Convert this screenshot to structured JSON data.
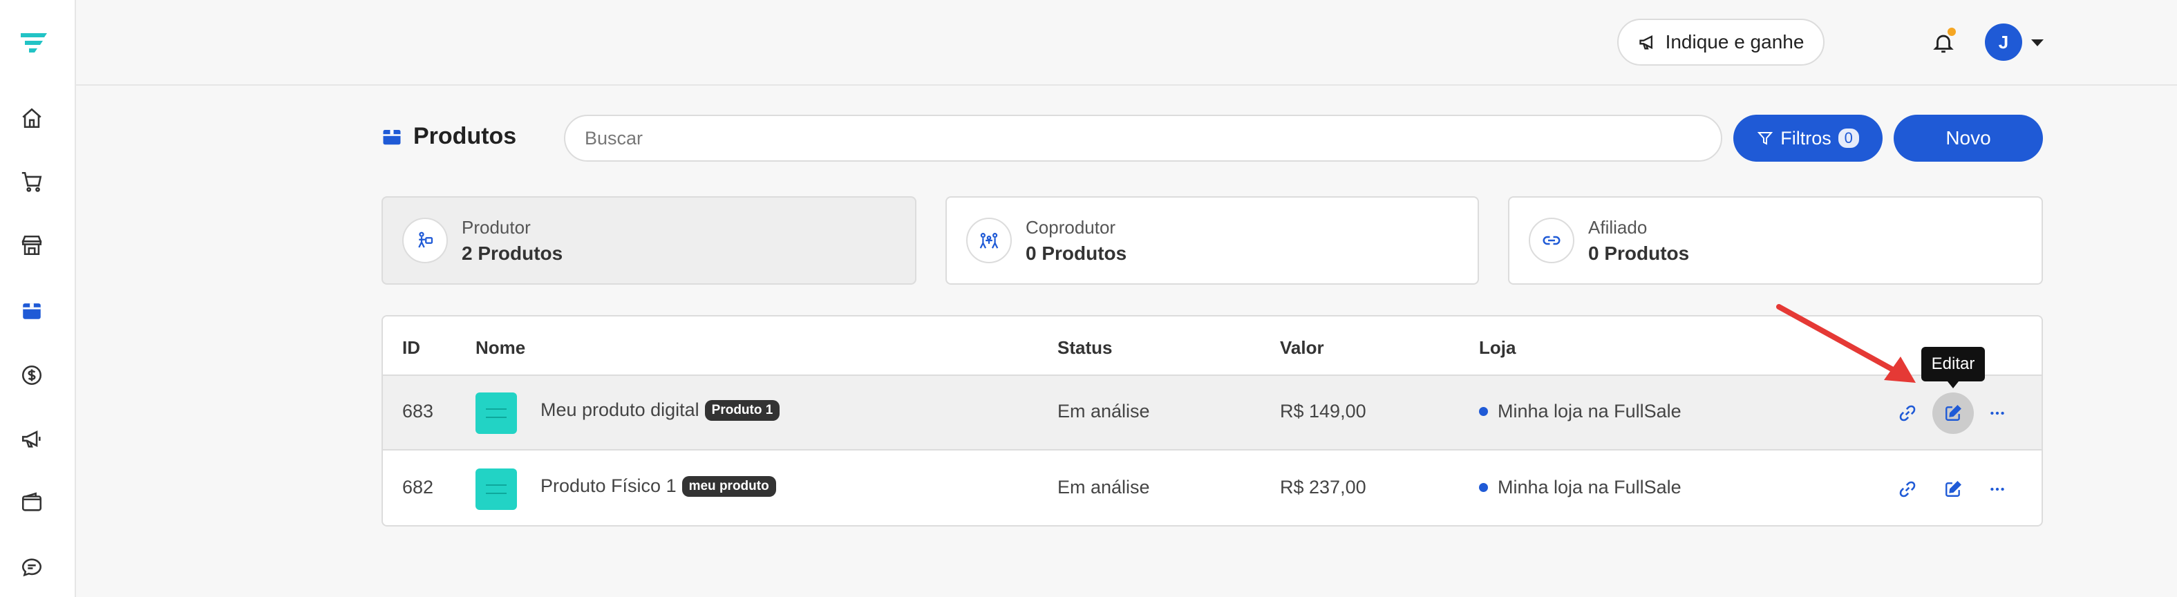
{
  "header": {
    "indique_label": "Indique e ganhe",
    "avatar_initial": "J"
  },
  "page": {
    "title": "Produtos",
    "search_placeholder": "Buscar",
    "filtros_label": "Filtros",
    "filtros_count": "0",
    "novo_label": "Novo"
  },
  "cards": [
    {
      "label": "Produtor",
      "count": "2 Produtos",
      "icon": "person-box-icon",
      "active": true
    },
    {
      "label": "Coprodutor",
      "count": "0 Produtos",
      "icon": "people-icon",
      "active": false
    },
    {
      "label": "Afiliado",
      "count": "0 Produtos",
      "icon": "link-icon",
      "active": false
    }
  ],
  "table": {
    "columns": {
      "id": "ID",
      "nome": "Nome",
      "status": "Status",
      "valor": "Valor",
      "loja": "Loja"
    },
    "rows": [
      {
        "id": "683",
        "nome": "Meu produto digital",
        "badge": "Produto 1",
        "status": "Em análise",
        "valor": "R$ 149,00",
        "loja": "Minha loja na FullSale"
      },
      {
        "id": "682",
        "nome": "Produto Físico 1",
        "badge": "meu produto",
        "status": "Em análise",
        "valor": "R$ 237,00",
        "loja": "Minha loja na FullSale"
      }
    ]
  },
  "tooltip": {
    "text": "Editar"
  },
  "colors": {
    "primary": "#1f5ad6",
    "logo": "#22c3c5",
    "thumb": "#22d3c5",
    "annotation": "#e53935",
    "notification": "#f5a623"
  }
}
